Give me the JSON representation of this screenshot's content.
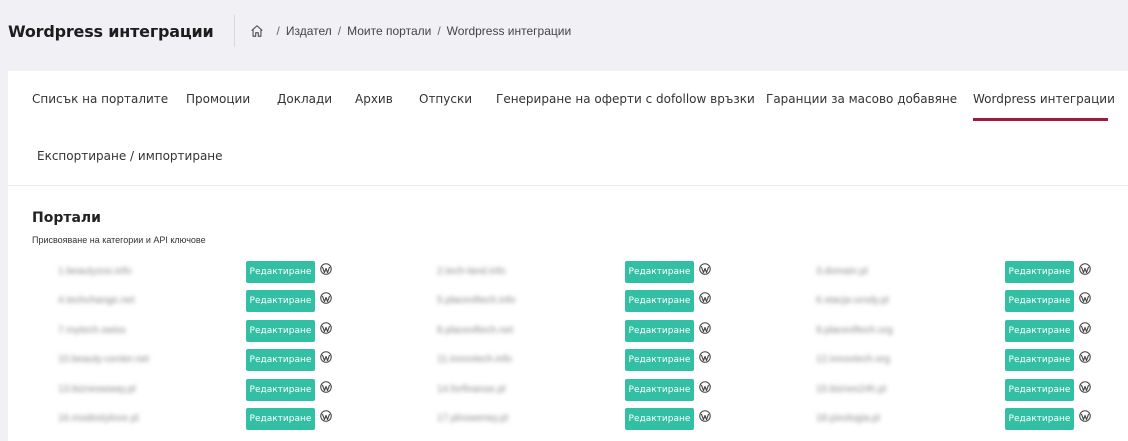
{
  "header": {
    "title": "Wordpress интеграции",
    "breadcrumb": [
      "Издател",
      "Моите портали",
      "Wordpress интеграции"
    ]
  },
  "tabs": [
    {
      "label": "Списък на порталите"
    },
    {
      "label": "Промоции"
    },
    {
      "label": "Доклади"
    },
    {
      "label": "Архив"
    },
    {
      "label": "Отпуски"
    },
    {
      "label": "Генериране на оферти с dofollow връзки"
    },
    {
      "label": "Гаранции за масово добавяне"
    },
    {
      "label": "Wordpress интеграции",
      "active": true
    },
    {
      "label": "Експортиране / импортиране"
    }
  ],
  "section": {
    "title": "Портали",
    "subtitle": "Присвояване на категории и API ключове"
  },
  "edit_label": "Редактиране",
  "icons": {
    "home": "home-icon",
    "wordpress": "wordpress-icon"
  },
  "colors": {
    "accent": "#a2183e",
    "button": "#33bfa3"
  },
  "portals": [
    [
      "1.beautyzoo.info",
      "2.tech-land.info",
      "3.domain.pl"
    ],
    [
      "4.techchange.net",
      "5.placeoftech.info",
      "6.stacja-urody.pl"
    ],
    [
      "7.mytech.swiss",
      "8.placeoftech.net",
      "9.placeoftech.org"
    ],
    [
      "10.beauty-center.net",
      "11.innovtech.info",
      "12.innovtech.org"
    ],
    [
      "13.bizneswway.pl",
      "14.forfinanse.pl",
      "15.biznes24h.pl"
    ],
    [
      "16.modestylove.pl",
      "17.plnowerwy.pl",
      "18.pixologia.pl"
    ]
  ]
}
